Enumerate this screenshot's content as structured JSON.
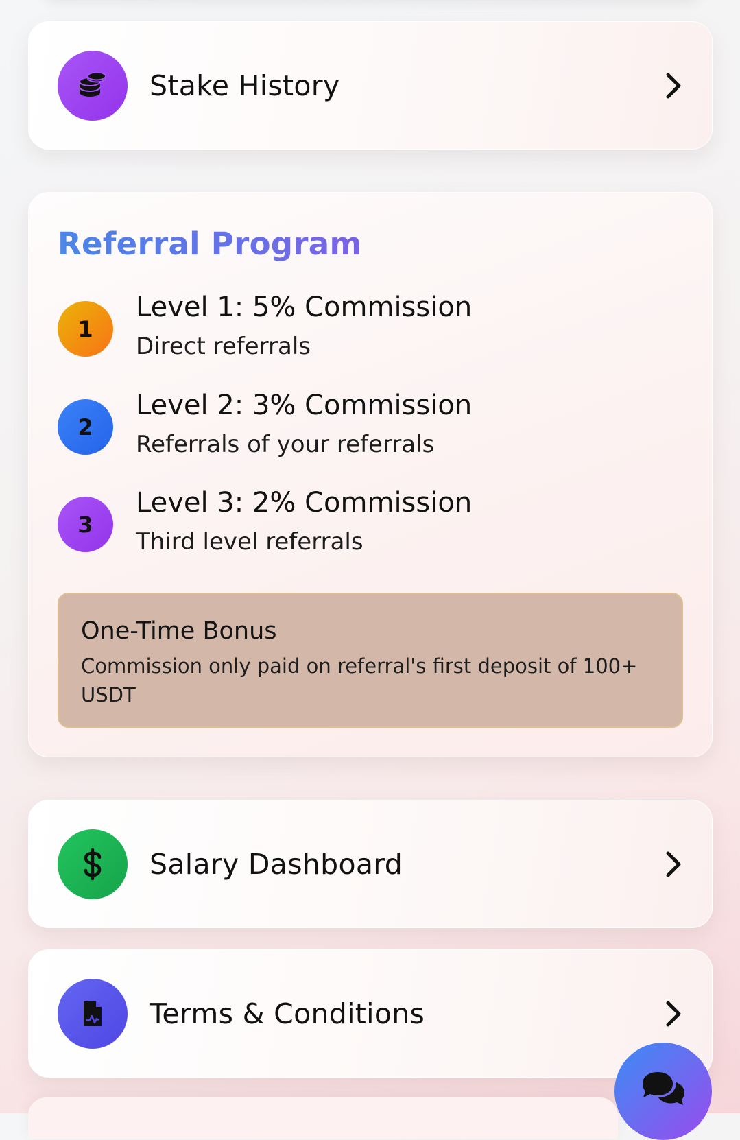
{
  "menu": {
    "stake_history": {
      "label": "Stake History",
      "icon": "coins-icon",
      "color_from": "#a855f7",
      "color_to": "#9333ea"
    },
    "salary_dashboard": {
      "label": "Salary Dashboard",
      "icon": "dollar-icon",
      "color_from": "#22c55e",
      "color_to": "#16a34a"
    },
    "terms": {
      "label": "Terms & Conditions",
      "icon": "document-icon",
      "color_from": "#6366f1",
      "color_to": "#4f46e5"
    }
  },
  "referral": {
    "title": "Referral Program",
    "levels": [
      {
        "badge": "1",
        "title": "Level 1: 5% Commission",
        "subtitle": "Direct referrals",
        "color_from": "#eab308",
        "color_to": "#f97316"
      },
      {
        "badge": "2",
        "title": "Level 2: 3% Commission",
        "subtitle": "Referrals of your referrals",
        "color_from": "#3b82f6",
        "color_to": "#2563eb"
      },
      {
        "badge": "3",
        "title": "Level 3: 2% Commission",
        "subtitle": "Third level referrals",
        "color_from": "#a855f7",
        "color_to": "#9333ea"
      }
    ],
    "bonus": {
      "title": "One-Time Bonus",
      "description": "Commission only paid on referral's first deposit of 100+ USDT"
    }
  },
  "chat": {
    "icon": "chat-icon"
  }
}
